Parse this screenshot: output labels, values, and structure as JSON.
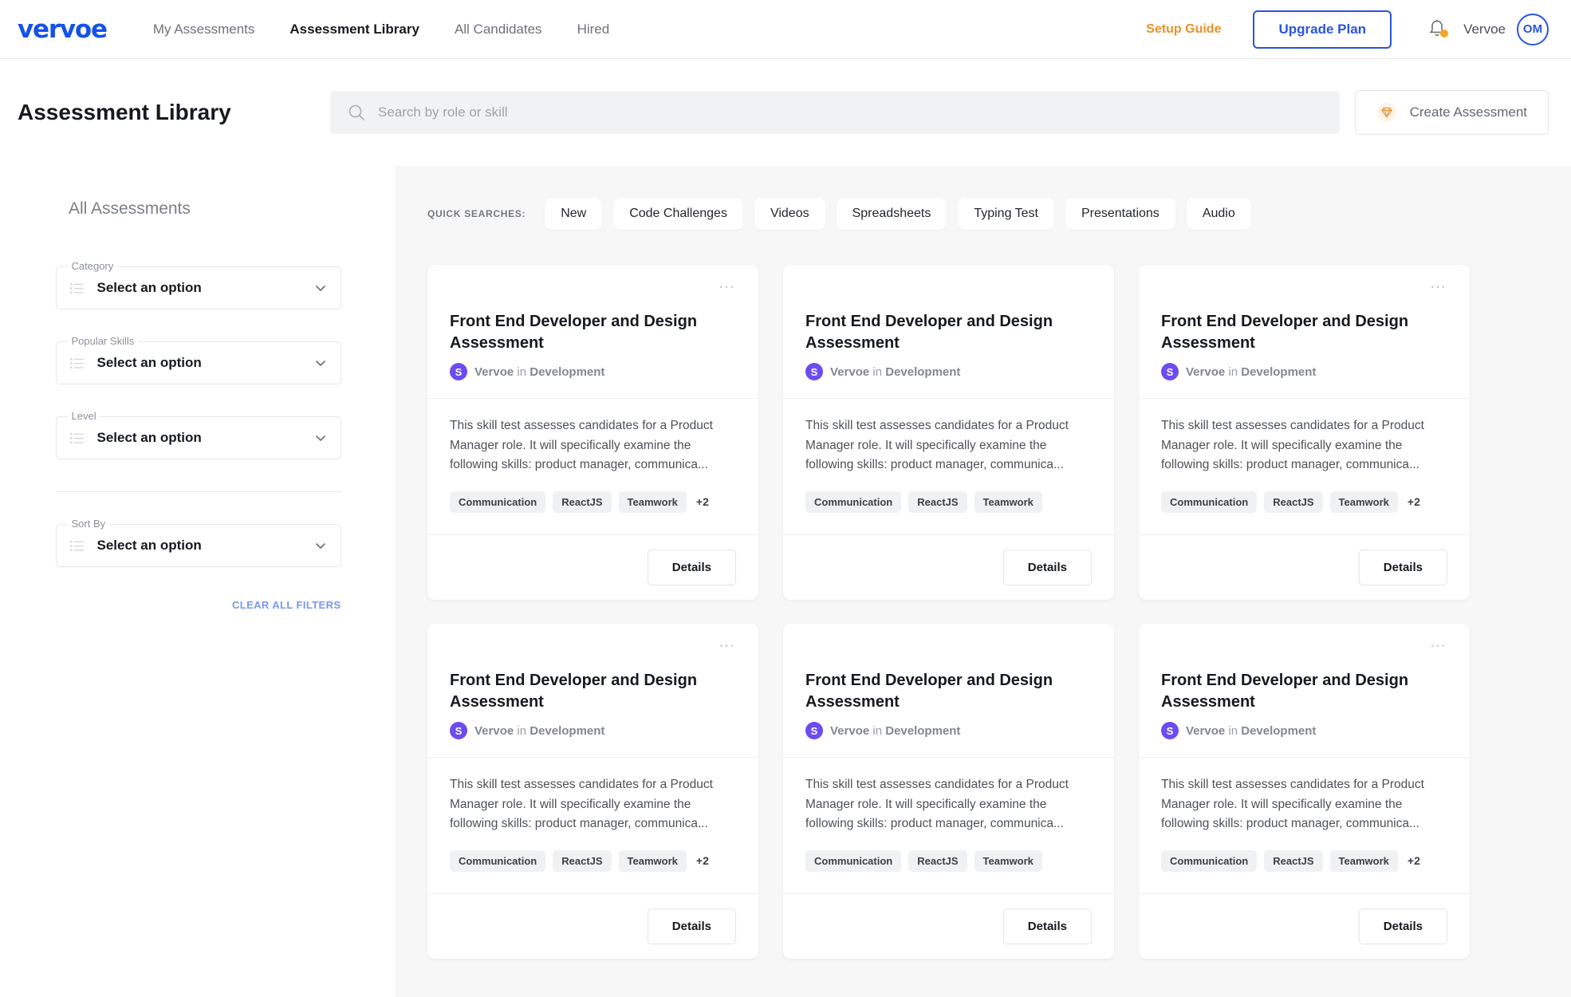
{
  "brand": {
    "logo_text": "vervoe",
    "logo_color": "#1552e8"
  },
  "topnav": {
    "links": [
      {
        "label": "My Assessments",
        "active": false
      },
      {
        "label": "Assessment Library",
        "active": true
      },
      {
        "label": "All Candidates",
        "active": false
      },
      {
        "label": "Hired",
        "active": false
      }
    ],
    "setup_guide_label": "Setup Guide",
    "setup_guide_color": "#e8912a",
    "upgrade_label": "Upgrade Plan",
    "upgrade_color": "#2a54e0",
    "notification_badge_color": "#f5a623",
    "user_name": "Vervoe",
    "avatar_initials": "OM"
  },
  "subheader": {
    "page_title": "Assessment Library",
    "search_placeholder": "Search by role or skill",
    "create_label": "Create Assessment"
  },
  "sidebar": {
    "title": "All Assessments",
    "filters": [
      {
        "label": "Category",
        "value": "Select an option"
      },
      {
        "label": "Popular Skills",
        "value": "Select an option"
      },
      {
        "label": "Level",
        "value": "Select an option"
      },
      {
        "label": "Sort By",
        "value": "Select an option"
      }
    ],
    "clear_all_label": "CLEAR ALL FILTERS",
    "clear_all_color": "#7b96ef"
  },
  "main": {
    "quick_searches_label": "QUICK SEARCHES:",
    "quick_searches": [
      "New",
      "Code Challenges",
      "Videos",
      "Spreadsheets",
      "Typing Test",
      "Presentations",
      "Audio"
    ],
    "cards": [
      {
        "title": "Front End Developer and Design Assessment",
        "author_initial": "S",
        "author": "Vervoe",
        "in_word": "in",
        "category": "Development",
        "description": "This skill test assesses candidates for a Product Manager role. It will specifically examine the following skills: product manager, communica...",
        "tags": [
          "Communication",
          "ReactJS",
          "Teamwork"
        ],
        "tag_more": "+2",
        "details_label": "Details",
        "has_menu": true
      },
      {
        "title": "Front End Developer and Design Assessment",
        "author_initial": "S",
        "author": "Vervoe",
        "in_word": "in",
        "category": "Development",
        "description": "This skill test assesses candidates for a Product Manager role. It will specifically examine the following skills: product manager, communica...",
        "tags": [
          "Communication",
          "ReactJS",
          "Teamwork"
        ],
        "tag_more": "",
        "details_label": "Details",
        "has_menu": false
      },
      {
        "title": "Front End Developer and Design Assessment",
        "author_initial": "S",
        "author": "Vervoe",
        "in_word": "in",
        "category": "Development",
        "description": "This skill test assesses candidates for a Product Manager role. It will specifically examine the following skills: product manager, communica...",
        "tags": [
          "Communication",
          "ReactJS",
          "Teamwork"
        ],
        "tag_more": "+2",
        "details_label": "Details",
        "has_menu": true
      },
      {
        "title": "Front End Developer and Design Assessment",
        "author_initial": "S",
        "author": "Vervoe",
        "in_word": "in",
        "category": "Development",
        "description": "This skill test assesses candidates for a Product Manager role. It will specifically examine the following skills: product manager, communica...",
        "tags": [
          "Communication",
          "ReactJS",
          "Teamwork"
        ],
        "tag_more": "+2",
        "details_label": "Details",
        "has_menu": true
      },
      {
        "title": "Front End Developer and Design Assessment",
        "author_initial": "S",
        "author": "Vervoe",
        "in_word": "in",
        "category": "Development",
        "description": "This skill test assesses candidates for a Product Manager role. It will specifically examine the following skills: product manager, communica...",
        "tags": [
          "Communication",
          "ReactJS",
          "Teamwork"
        ],
        "tag_more": "",
        "details_label": "Details",
        "has_menu": false
      },
      {
        "title": "Front End Developer and Design Assessment",
        "author_initial": "S",
        "author": "Vervoe",
        "in_word": "in",
        "category": "Development",
        "description": "This skill test assesses candidates for a Product Manager role. It will specifically examine the following skills: product manager, communica...",
        "tags": [
          "Communication",
          "ReactJS",
          "Teamwork"
        ],
        "tag_more": "+2",
        "details_label": "Details",
        "has_menu": true
      }
    ]
  }
}
